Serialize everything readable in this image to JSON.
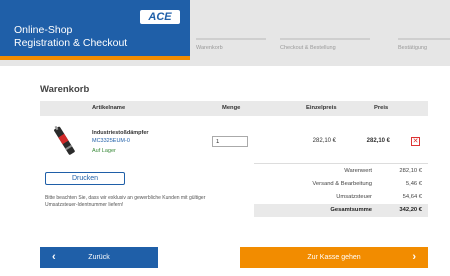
{
  "header": {
    "brand_line1": "Online-Shop",
    "brand_line2": "Registration & Checkout",
    "logo_text": "ACE",
    "steps": [
      "Warenkorb",
      "Checkout & Bestellung",
      "Bestätigung"
    ]
  },
  "cart": {
    "title": "Warenkorb",
    "columns": {
      "name": "Artikelname",
      "qty": "Menge",
      "unit_price": "Einzelpreis",
      "price": "Preis"
    },
    "items": [
      {
        "name": "Industriestoßdämpfer",
        "sku": "MC3325EUM-0",
        "stock": "Auf Lager",
        "quantity": "1",
        "unit_price": "282,10 €",
        "price": "282,10 €"
      }
    ],
    "remove_icon": "close-icon"
  },
  "totals": [
    {
      "label": "Warenwert",
      "value": "282,10 €"
    },
    {
      "label": "Versand & Bearbeitung",
      "value": "5,46 €"
    },
    {
      "label": "Umsatzsteuer",
      "value": "54,64 €"
    },
    {
      "label": "Gesamtsumme",
      "value": "342,20 €"
    }
  ],
  "actions": {
    "print_label": "Drucken",
    "notice": "Bitte beachten Sie, dass wir exklusiv an gewerbliche Kunden mit gültiger Umsatzsteuer-Identnummer liefern!",
    "back_label": "Zurück",
    "checkout_label": "Zur Kasse gehen"
  },
  "colors": {
    "brand_blue": "#1f5fa8",
    "accent_orange": "#f28c00",
    "remove_red": "#d33333",
    "stock_green": "#3a8a3a"
  }
}
